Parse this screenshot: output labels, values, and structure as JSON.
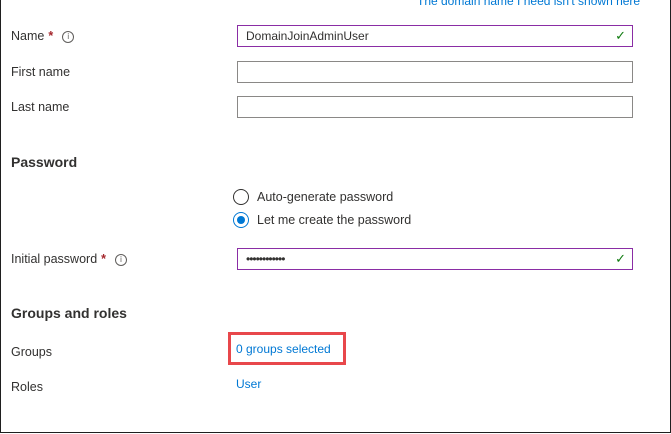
{
  "top_link": "The domain name I need isn't shown here",
  "identity": {
    "name_label": "Name",
    "required_mark": "*",
    "info_glyph": "i",
    "name_value": "DomainJoinAdminUser",
    "first_name_label": "First name",
    "first_name_value": "",
    "last_name_label": "Last name",
    "last_name_value": ""
  },
  "password": {
    "heading": "Password",
    "options": [
      {
        "label": "Auto-generate password",
        "checked": false
      },
      {
        "label": "Let me create the password",
        "checked": true
      }
    ],
    "initial_label": "Initial password",
    "initial_value": "••••••••••••"
  },
  "groups_roles": {
    "heading": "Groups and roles",
    "groups_label": "Groups",
    "groups_link": "0 groups selected",
    "roles_label": "Roles",
    "roles_link": "User"
  },
  "icons": {
    "valid_check": "✓"
  },
  "colors": {
    "link": "#0078d4",
    "valid_border": "#8a2da5",
    "check": "#107c10",
    "highlight": "#e8474b",
    "required": "#a4262c"
  }
}
